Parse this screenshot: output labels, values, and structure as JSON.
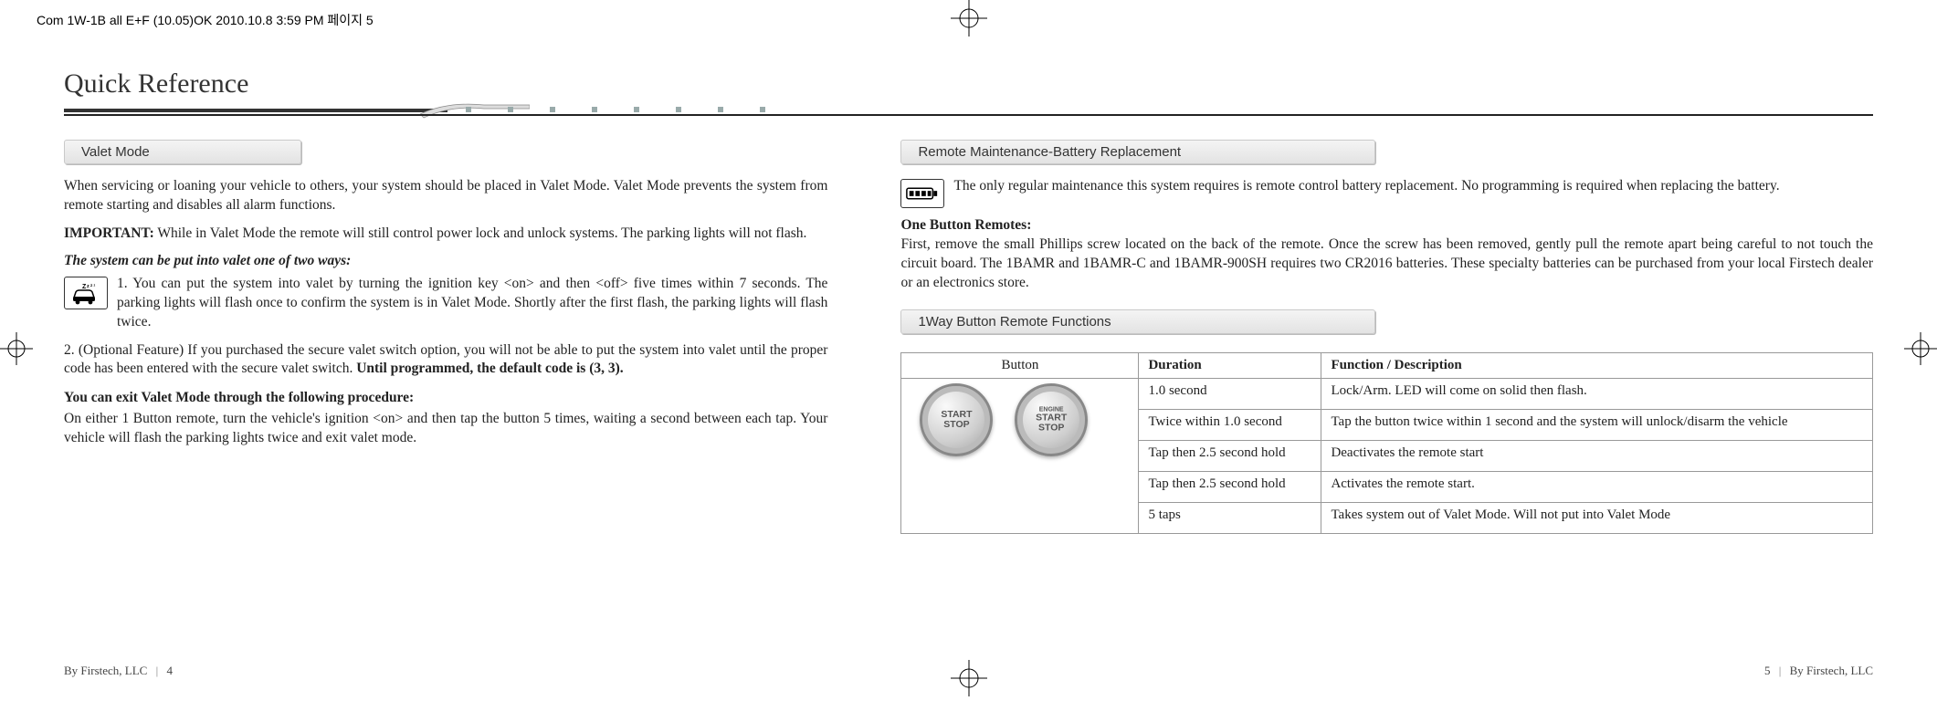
{
  "print_header": "Com 1W-1B all E+F (10.05)OK  2010.10.8 3:59 PM 페이지 5",
  "page_title": "Quick Reference",
  "left": {
    "section_title": "Valet Mode",
    "para1": "When servicing or loaning your vehicle to others, your system should be placed in Valet Mode. Valet Mode prevents the system from remote starting and disables all alarm functions.",
    "important_label": "IMPORTANT:",
    "important_text": "  While in Valet Mode the remote will still control power lock and unlock systems. The parking lights will not flash.",
    "ways_heading": "The system can be put into valet one of two ways:",
    "way1": "1. You can put the system into valet by turning the ignition key <on> and then <off> five times within 7 seconds. The parking lights will flash once to confirm the system is in Valet Mode. Shortly after the first flash, the parking lights will flash twice.",
    "way2_a": "2. (Optional Feature) If you purchased the secure valet switch option, you will not be able to put the system into valet until the proper code has been entered with the secure valet switch. ",
    "way2_b": "Until programmed, the default code is (3, 3).",
    "exit_heading": "You can exit Valet Mode through the following procedure:",
    "exit_text": "On either 1 Button remote, turn the vehicle's ignition <on> and then tap the button 5 times, waiting a second between each tap. Your vehicle will flash the parking lights twice and exit valet mode."
  },
  "right": {
    "section1_title": "Remote Maintenance-Battery Replacement",
    "maint_text": "The only regular maintenance this system requires is remote control battery replacement.    No programming is required when replacing the battery.",
    "one_button_heading": "One Button Remotes:",
    "one_button_text": "First, remove the small Phillips screw located on the back of the remote. Once the screw has been removed, gently pull the remote apart being careful to not touch the circuit board. The 1BAMR and 1BAMR-C and 1BAMR-900SH requires two CR2016 batteries. These specialty batteries can be purchased from your local Firstech dealer or an electronics store.",
    "section2_title": "1Way Button Remote Functions",
    "table": {
      "headers": {
        "button": "Button",
        "duration": "Duration",
        "function": "Function / Description"
      },
      "btn1_label": "START\nSTOP",
      "btn2_top": "ENGINE",
      "btn2_label": "START\nSTOP",
      "rows": [
        {
          "duration": "1.0 second",
          "func": "Lock/Arm. LED will come on solid then flash."
        },
        {
          "duration": "Twice within 1.0 second",
          "func": "Tap the button twice within 1 second and the system will unlock/disarm the vehicle"
        },
        {
          "duration": "Tap then 2.5 second hold",
          "func": "Deactivates the remote start"
        },
        {
          "duration": "Tap then 2.5 second hold",
          "func": "Activates the remote start."
        },
        {
          "duration": "5 taps",
          "func": "Takes system out of Valet Mode. Will not put into Valet Mode"
        }
      ]
    }
  },
  "footer": {
    "left_company": "By Firstech, LLC",
    "left_page": "4",
    "right_page": "5",
    "right_company": "By Firstech, LLC"
  }
}
